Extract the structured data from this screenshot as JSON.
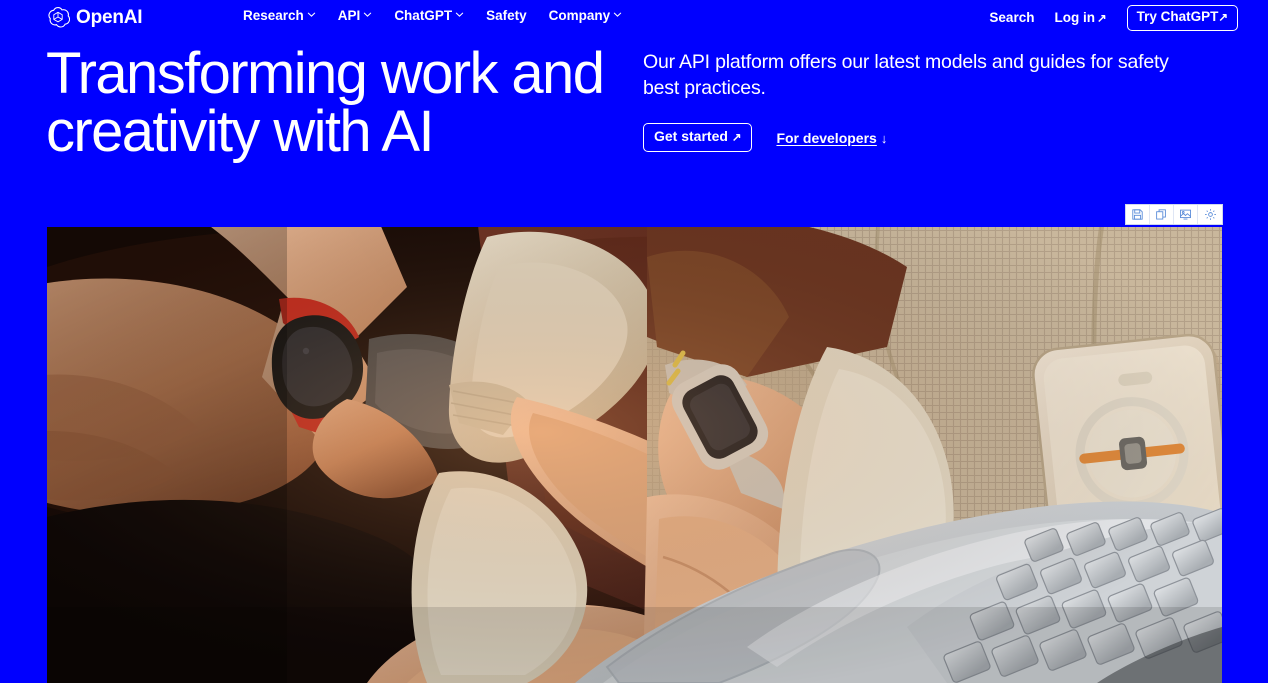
{
  "brand": {
    "name": "OpenAI",
    "logo_icon": "openai-logo-icon"
  },
  "nav": {
    "items": [
      {
        "label": "Research",
        "has_dropdown": true
      },
      {
        "label": "API",
        "has_dropdown": true
      },
      {
        "label": "ChatGPT",
        "has_dropdown": true
      },
      {
        "label": "Safety",
        "has_dropdown": false
      },
      {
        "label": "Company",
        "has_dropdown": true
      }
    ],
    "search_label": "Search",
    "login_label": "Log in",
    "login_arrow": "↗",
    "cta_label": "Try ChatGPT",
    "cta_arrow": "↗"
  },
  "hero": {
    "title": "Transforming work and creativity with AI",
    "description": "Our API platform offers our latest models and guides for safety best practices.",
    "primary_button_label": "Get started",
    "primary_button_arrow": "↗",
    "secondary_link_label": "For developers",
    "secondary_link_arrow": "↓"
  },
  "image_toolbar": {
    "buttons": [
      {
        "name": "save-icon",
        "tooltip": "Save"
      },
      {
        "name": "copy-icon",
        "tooltip": "Copy"
      },
      {
        "name": "image-icon",
        "tooltip": "Image"
      },
      {
        "name": "settings-gear-icon",
        "tooltip": "Settings"
      }
    ]
  },
  "hero_image": {
    "alt": "Three people sitting close together on a textured beige couch, hands resting on and typing at a silver laptop. One wrist wears a red-banded smartwatch, another a silver Apple Watch on a woven band; a gold iPhone with a MagSafe accessory rests on the cushion to the right.",
    "colors": {
      "background_blue": "#0000FF",
      "text_white": "#FFFFFF",
      "photo_dark": "#140a06",
      "photo_brown_shirt": "#5a2a1c",
      "photo_cream": "#ded2bd",
      "photo_couch": "#c9b79c",
      "photo_laptop_silver": "#cfd2d6",
      "photo_watch_red": "#c22a20"
    }
  }
}
